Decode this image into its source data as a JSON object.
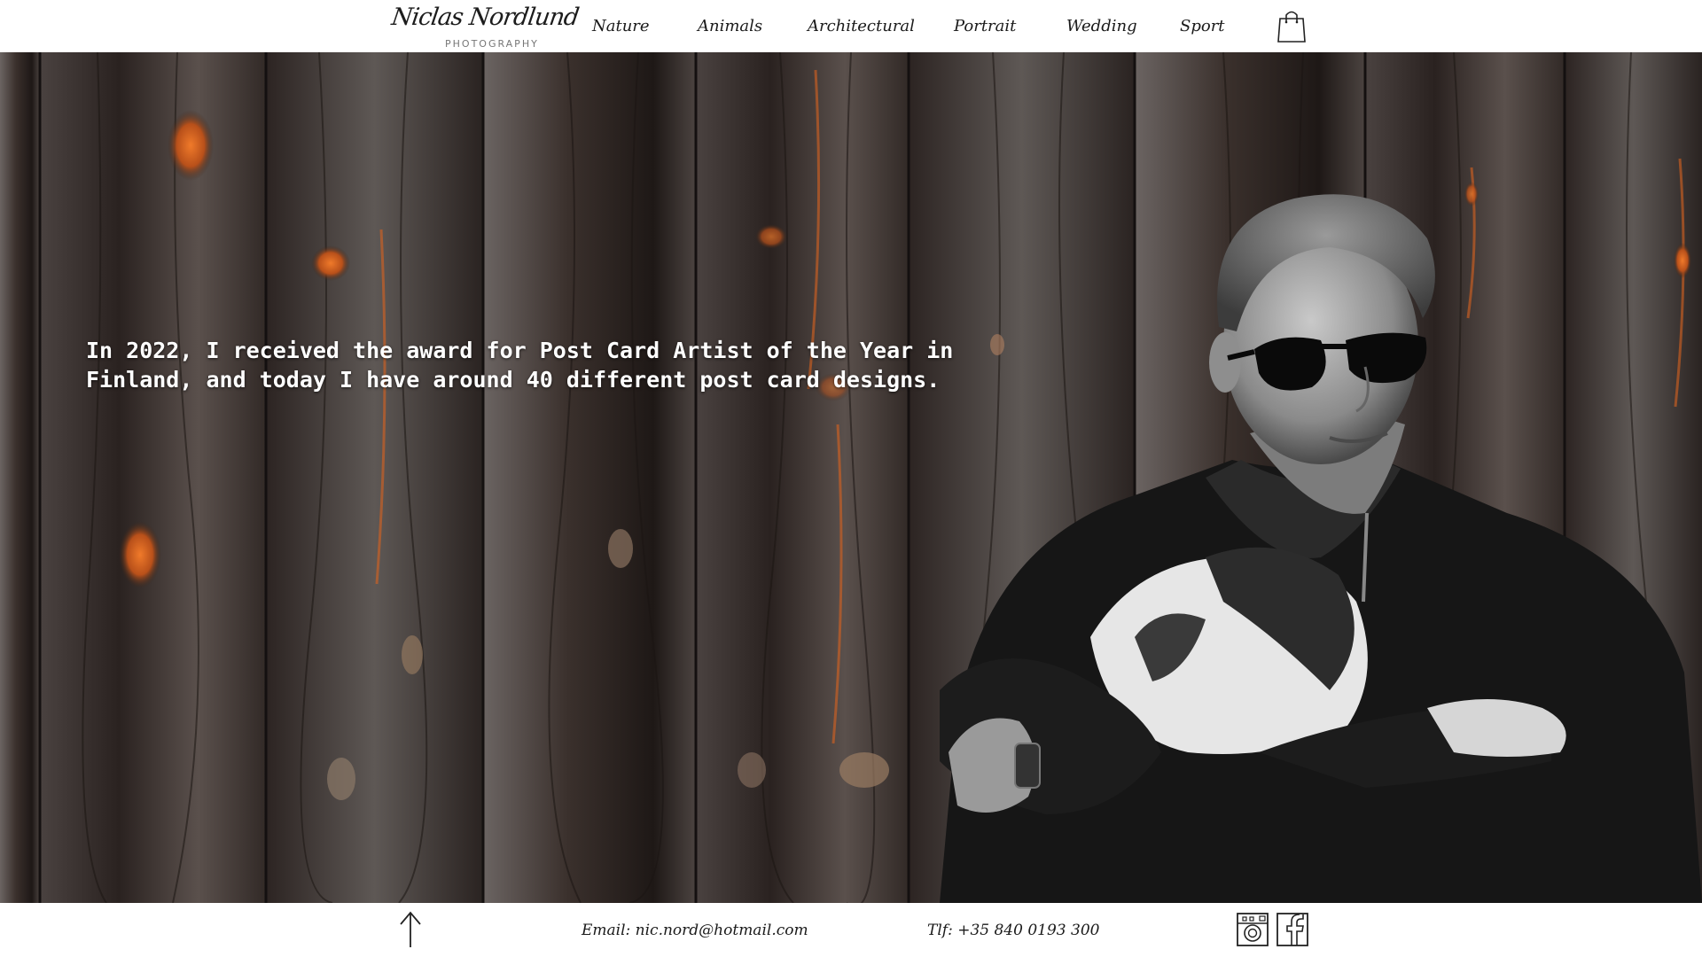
{
  "header": {
    "logo_script": "Niclas Nordlund",
    "logo_sub": "PHOTOGRAPHY",
    "nav": [
      {
        "label": "Nature"
      },
      {
        "label": "Animals"
      },
      {
        "label": "Architectural"
      },
      {
        "label": "Portrait"
      },
      {
        "label": "Wedding"
      },
      {
        "label": "Sport"
      }
    ],
    "cart_icon": "shopping-bag-icon"
  },
  "hero": {
    "text": "In 2022, I received the award for Post Card Artist of the Year in Finland, and today I have around 40 different post card designs."
  },
  "footer": {
    "email": "Email: nic.nord@hotmail.com",
    "phone": "Tlf: +35 840 0193 300",
    "icons": [
      "arrow-up-icon",
      "instagram-icon",
      "facebook-icon"
    ]
  },
  "colors": {
    "header_bg": "#ffffff",
    "text_dark": "#1a1a1a",
    "wood_dark": "#2b2421",
    "wood_orange": "#e0651e"
  }
}
